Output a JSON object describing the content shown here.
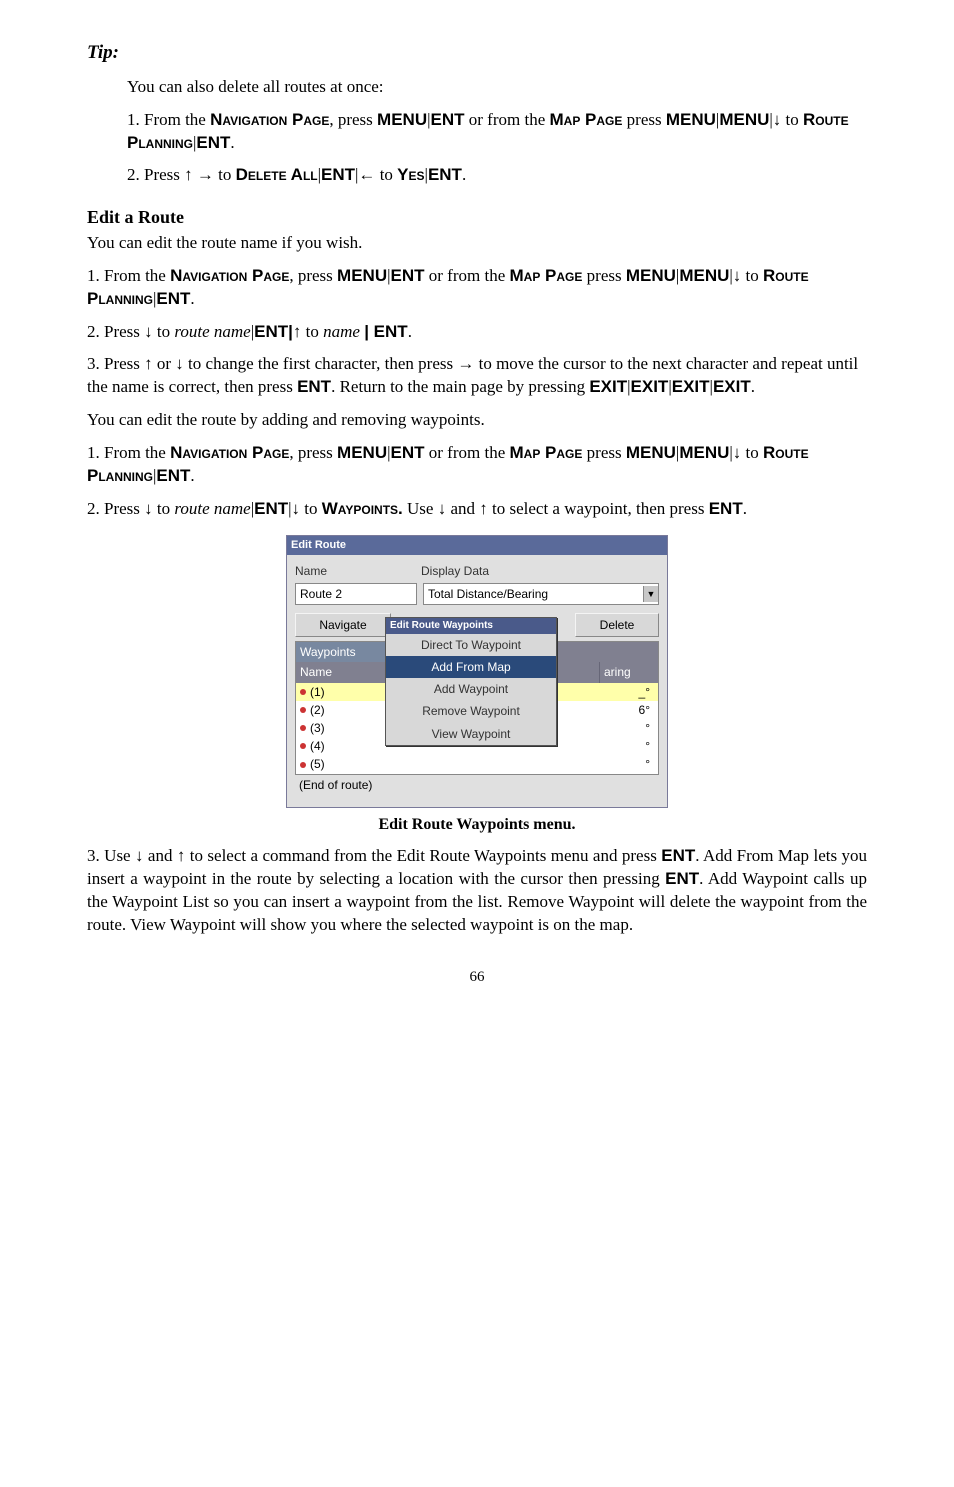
{
  "tip": {
    "heading": "Tip:",
    "line1": "You can also delete all routes at once:",
    "step1_a": "1. From the ",
    "nav_page": "Navigation Page",
    "step1_b": ", press ",
    "menu": "MENU",
    "ent": "ENT",
    "or_from": " or from the ",
    "map_page": "Map Page",
    "press": " press ",
    "to": " to ",
    "route_planning": "Route Planning",
    "step2_a": "2. Press ",
    "delete_all": "Delete All",
    "yes": "Yes"
  },
  "edit": {
    "heading": "Edit a Route",
    "intro": "You can edit the route name if you wish.",
    "s1a": "1. From the ",
    "s2a": "2. Press ",
    "route_name": "route name",
    "name": "name",
    "s3": "3. Press ↑ or ↓ to change the first character, then press → to move the cursor to the next character and repeat until the name is correct, then press ",
    "return": ". Return to the main page by pressing ",
    "exit": "EXIT",
    "can_edit": "You can edit the route by adding and removing waypoints.",
    "waypoints": "Waypoints.",
    "use": " Use ↓ and ↑ to select a waypoint, then press "
  },
  "screenshot": {
    "title": "Edit Route",
    "name_label": "Name",
    "display_label": "Display Data",
    "route_value": "Route 2",
    "dd_value": "Total Distance/Bearing",
    "navigate": "Navigate",
    "delete": "Delete",
    "wp_tab": "Waypoints",
    "col_name": "Name",
    "col_bearing": "aring",
    "menu_title": "Edit Route Waypoints",
    "menu_items": [
      "Direct To Waypoint",
      "Add From Map",
      "Add Waypoint",
      "Remove Waypoint",
      "View Waypoint"
    ],
    "rows": [
      "(1)",
      "(2)",
      "(3)",
      "(4)",
      "(5)"
    ],
    "end": "(End of route)",
    "deg6": "6°",
    "dash": "_°"
  },
  "caption": "Edit Route Waypoints menu.",
  "para3": {
    "a": "3. Use ↓ and ↑ to select a command from the Edit Route Waypoints menu and press ",
    "b": ". Add From Map lets you insert a waypoint in the route by selecting a location with the cursor then pressing ",
    "c": ". Add Waypoint calls up the Waypoint List so you can insert a waypoint from the list. Remove Waypoint will delete the waypoint from the route. View Waypoint will show you where the selected waypoint is on the map."
  },
  "pagenum": "66"
}
